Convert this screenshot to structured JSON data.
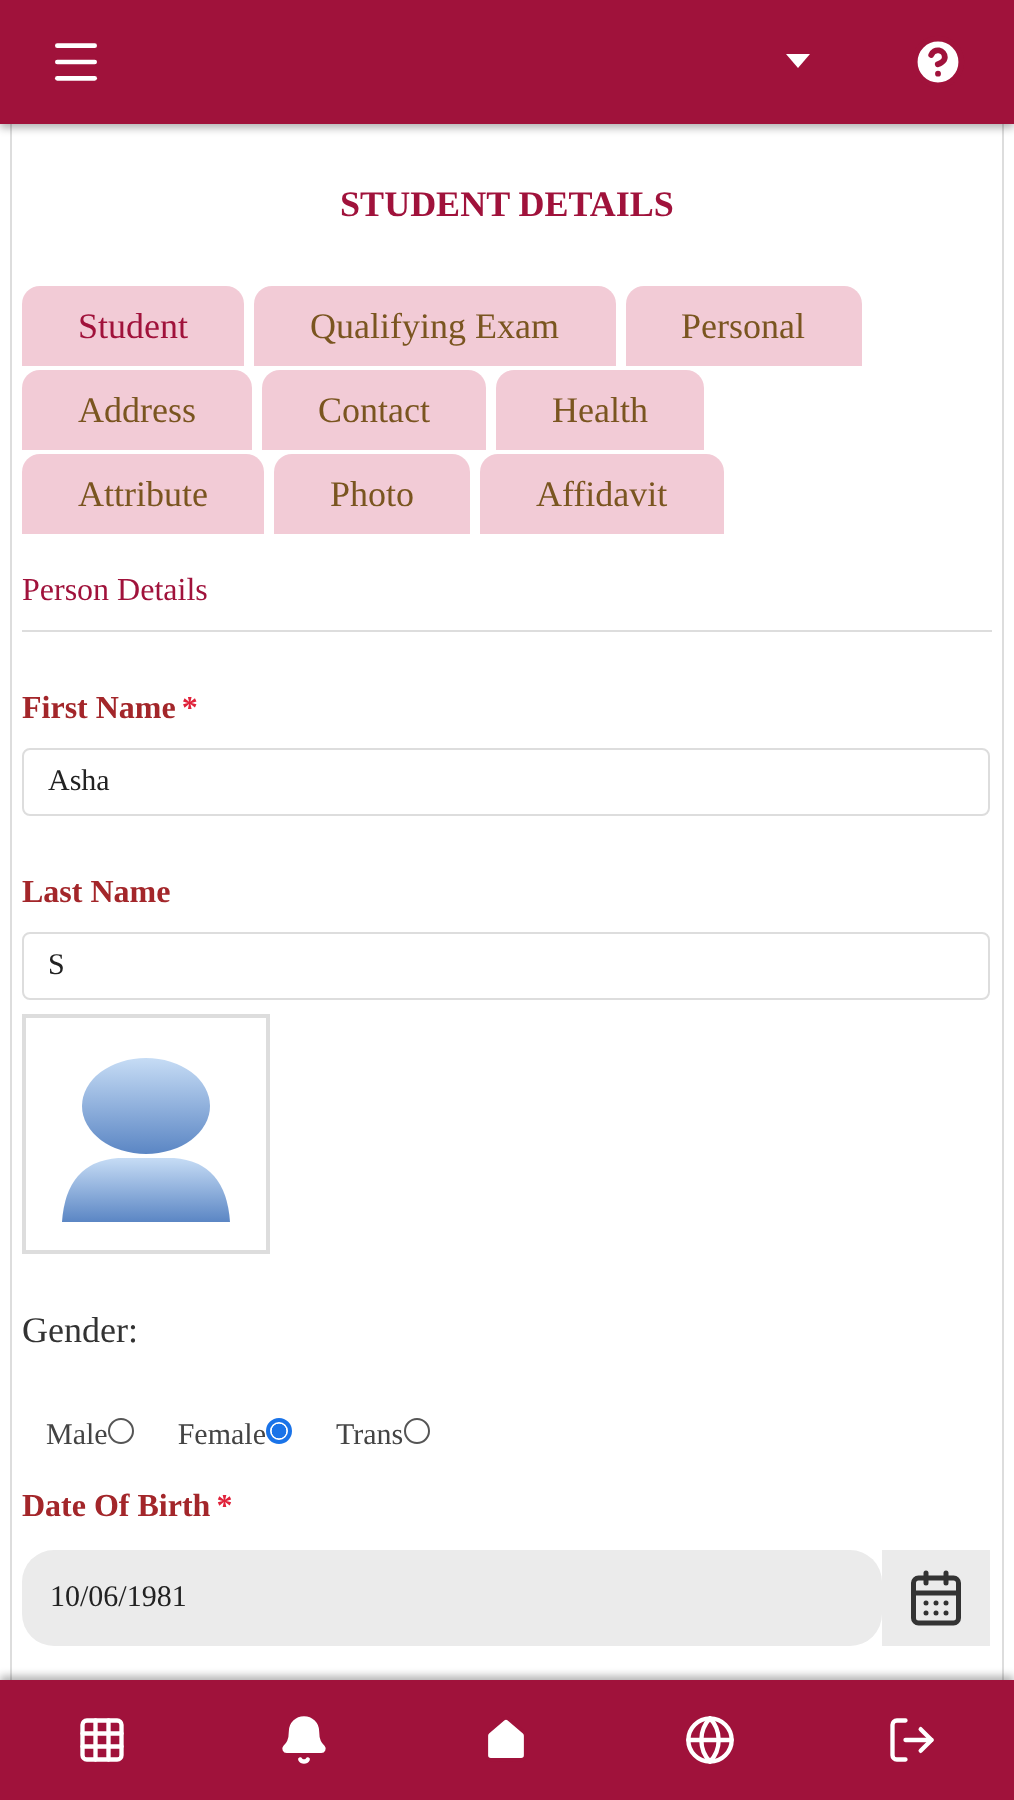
{
  "page_title": "STUDENT DETAILS",
  "tabs": [
    {
      "label": "Student",
      "selected": true
    },
    {
      "label": "Qualifying Exam",
      "selected": false
    },
    {
      "label": "Personal",
      "selected": false
    },
    {
      "label": "Address",
      "selected": false
    },
    {
      "label": "Contact",
      "selected": false
    },
    {
      "label": "Health",
      "selected": false
    },
    {
      "label": "Attribute",
      "selected": false
    },
    {
      "label": "Photo",
      "selected": false
    },
    {
      "label": "Affidavit",
      "selected": false
    }
  ],
  "section_title": "Person Details",
  "first_name": {
    "label": "First Name",
    "required_mark": "*",
    "value": "Asha"
  },
  "last_name": {
    "label": "Last Name",
    "value": "S"
  },
  "gender": {
    "label": "Gender:",
    "options": [
      {
        "label": "Male",
        "selected": false
      },
      {
        "label": "Female",
        "selected": true
      },
      {
        "label": "Trans",
        "selected": false
      }
    ]
  },
  "date_of_birth": {
    "label": "Date Of Birth",
    "required_mark": "*",
    "value": "10/06/1981"
  },
  "bottom_nav": [
    {
      "kind": "grid"
    },
    {
      "kind": "bell"
    },
    {
      "kind": "home"
    },
    {
      "kind": "globe"
    },
    {
      "kind": "logout"
    }
  ]
}
